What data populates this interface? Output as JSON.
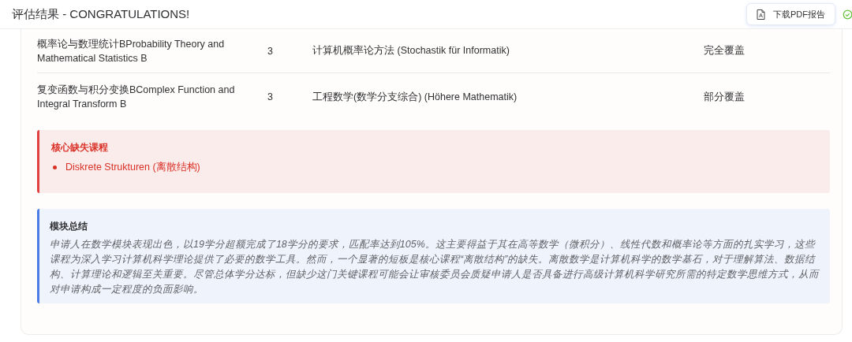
{
  "header": {
    "title": "评估结果 - CONGRATULATIONS!",
    "download_button": "下载PDF报告"
  },
  "table": {
    "rows": [
      {
        "course": "概率论与数理统计BProbability Theory and Mathematical Statistics B",
        "credits": "3",
        "matched_course": "计算机概率论方法 (Stochastik für Informatik)",
        "coverage": "完全覆盖"
      },
      {
        "course": "复变函数与积分变换BComplex Function and Integral Transform B",
        "credits": "3",
        "matched_course": "工程数学(数学分支综合) (Höhere Mathematik)",
        "coverage": "部分覆盖"
      }
    ]
  },
  "missing": {
    "title": "核心缺失课程",
    "items": [
      "Diskrete Strukturen (离散结构)"
    ]
  },
  "summary": {
    "title": "模块总结",
    "text": "申请人在数学模块表现出色，以19学分超额完成了18学分的要求，匹配率达到105%。这主要得益于其在高等数学（微积分）、线性代数和概率论等方面的扎实学习，这些课程为深入学习计算机科学理论提供了必要的数学工具。然而，一个显著的短板是核心课程“离散结构”的缺失。离散数学是计算机科学的数学基石，对于理解算法、数据结构、计算理论和逻辑至关重要。尽管总体学分达标，但缺少这门关键课程可能会让审核委员会质疑申请人是否具备进行高级计算机科学研究所需的特定数学思维方式，从而对申请构成一定程度的负面影响。"
  }
}
